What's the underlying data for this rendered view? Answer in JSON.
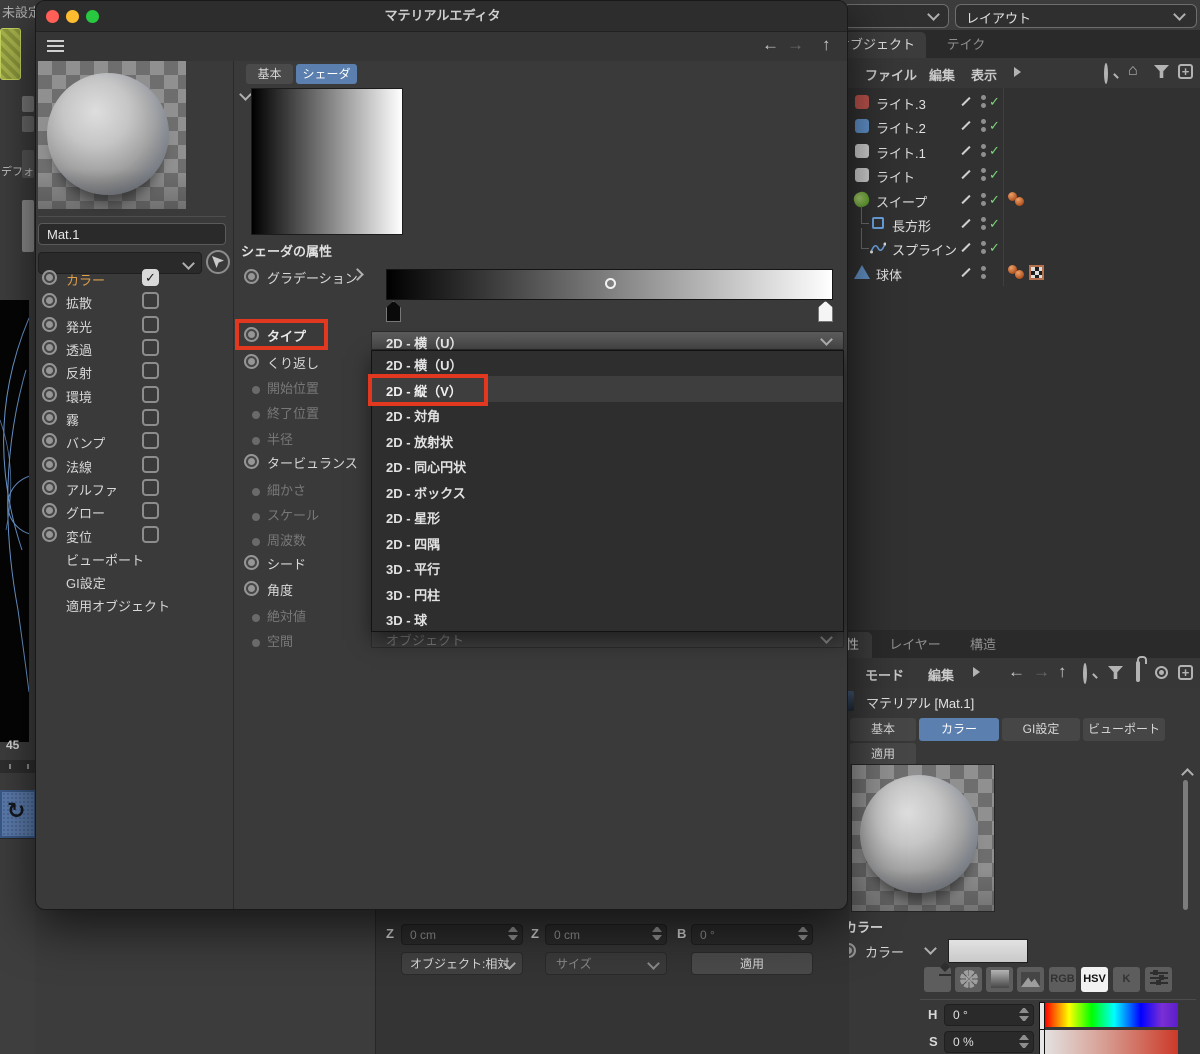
{
  "window": {
    "title": "マテリアルエディタ",
    "tab_basic": "基本",
    "tab_shader": "シェーダ",
    "material_name": "Mat.1",
    "channels": [
      {
        "label": "カラー",
        "checked": true
      },
      {
        "label": "拡散"
      },
      {
        "label": "発光"
      },
      {
        "label": "透過"
      },
      {
        "label": "反射"
      },
      {
        "label": "環境"
      },
      {
        "label": "霧"
      },
      {
        "label": "バンプ"
      },
      {
        "label": "法線"
      },
      {
        "label": "アルファ"
      },
      {
        "label": "グロー"
      },
      {
        "label": "変位"
      }
    ],
    "pages": [
      "ビューポート",
      "GI設定",
      "適用オブジェクト"
    ],
    "shader": {
      "header": "シェーダの属性",
      "gradient_label": "グラデーション",
      "type_label": "タイプ",
      "type_value": "2D - 横（U）",
      "params": [
        {
          "label": "くり返し"
        },
        {
          "label": "開始位置"
        },
        {
          "label": "終了位置"
        },
        {
          "label": "半径"
        },
        {
          "label": "タービュランス"
        },
        {
          "label": "細かさ"
        },
        {
          "label": "スケール"
        },
        {
          "label": "周波数"
        },
        {
          "label": "シード"
        },
        {
          "label": "角度"
        },
        {
          "label": "絶対値"
        },
        {
          "label": "空間"
        }
      ],
      "dropdown": [
        "2D - 横（U）",
        "2D - 縦（V）",
        "2D - 対角",
        "2D - 放射状",
        "2D - 同心円状",
        "2D - ボックス",
        "2D - 星形",
        "2D - 四隅",
        "3D - 平行",
        "3D - 円柱",
        "3D - 球"
      ],
      "highlighted_option": "2D - 縦（V）",
      "space_value": "オブジェクト"
    }
  },
  "left_strip": {
    "unset": "未設定",
    "default_label": "デフォ",
    "frame": "45"
  },
  "top_bar": {
    "layout": "レイアウト"
  },
  "object_manager": {
    "tab_object": "オブジェクト",
    "tab_take": "テイク",
    "menu": {
      "file": "ファイル",
      "edit": "編集",
      "view": "表示"
    },
    "objects": [
      {
        "name": "ライト.3"
      },
      {
        "name": "ライト.2"
      },
      {
        "name": "ライト.1"
      },
      {
        "name": "ライト"
      },
      {
        "name": "スイープ"
      },
      {
        "name": "長方形"
      },
      {
        "name": "スプライン"
      },
      {
        "name": "球体"
      }
    ]
  },
  "attribute_manager": {
    "tab_attr": "属性",
    "tab_layer": "レイヤー",
    "tab_struct": "構造",
    "menu": {
      "mode": "モード",
      "edit": "編集"
    },
    "title": "マテリアル [Mat.1]",
    "tabs": {
      "basic": "基本",
      "color": "カラー",
      "gi": "GI設定",
      "viewport": "ビューポート",
      "apply": "適用"
    },
    "color": {
      "header": "カラー",
      "label": "カラー",
      "rgb": "RGB",
      "hsv": "HSV",
      "k": "K",
      "h_label": "H",
      "h_value": "0 °",
      "s_label": "S",
      "s_value": "0 %"
    }
  },
  "coordinates": {
    "z1_label": "Z",
    "z1_value": "0 cm",
    "z2_label": "Z",
    "z2_value": "0 cm",
    "b_label": "B",
    "b_value": "0 °",
    "mode": "オブジェクト:相対",
    "size": "サイズ",
    "apply": "適用"
  },
  "colors": {
    "annotation": "#e23820",
    "tab_selected": "#5b7fae",
    "check_green": "#7ed87e",
    "color_channel_text": "#dd9f4a"
  }
}
